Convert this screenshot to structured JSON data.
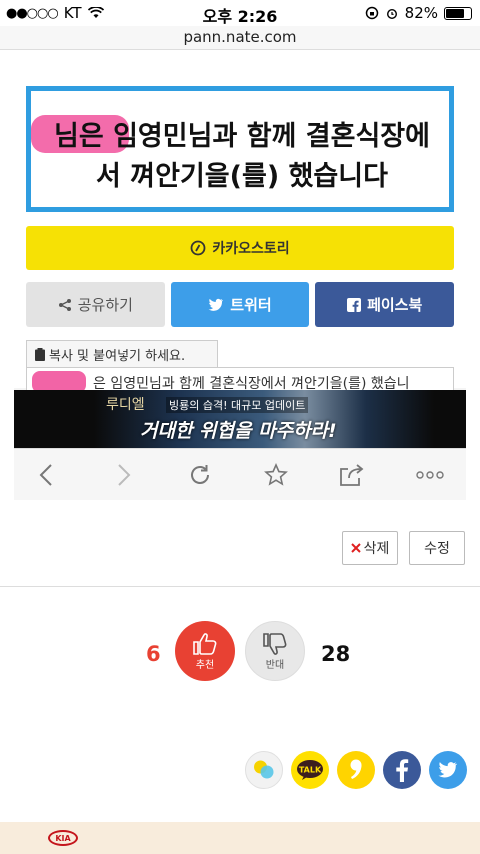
{
  "status_bar": {
    "signal_dots": "●●○○○",
    "carrier": "KT",
    "time": "오후 2:26",
    "battery": "82%",
    "battery_level": 0.82
  },
  "address_bar": {
    "url": "pann.nate.com"
  },
  "screenshot": {
    "headline": "님은 임영민님과 함께 결혼식장에서 껴안기을(를) 했습니다",
    "kakao_story_label": "카카오스토리",
    "share_label": "공유하기",
    "twitter_label": "트위터",
    "facebook_label": "페이스북",
    "copy_hint": "복사 및 붙여넣기 하세요.",
    "copy_text": "은 임영민님과 함께 결혼식장에서 껴안기을(를) 했습니",
    "ad": {
      "logo": "루디엘",
      "sub": "빙룡의 습격! 대규모 업데이트",
      "main": "거대한 위협을 마주하라!"
    },
    "toolbar": {
      "back_icon": "chevron-left-icon",
      "forward_icon": "chevron-right-icon",
      "reload_icon": "reload-icon",
      "bookmark_icon": "star-icon",
      "share_icon": "share-icon",
      "more_icon": "more-dots-icon"
    }
  },
  "actions": {
    "delete_label": "삭제",
    "edit_label": "수정"
  },
  "votes": {
    "up_count": "6",
    "up_label": "추천",
    "down_count": "28",
    "down_label": "반대"
  },
  "sns": [
    "kakaostory-icon",
    "kakaotalk-icon",
    "kakao-quote-icon",
    "facebook-icon",
    "twitter-icon"
  ],
  "sns_talk_label": "TALK",
  "footer": {
    "logo": "KIA"
  },
  "colors": {
    "accent_blue": "#2f9de0",
    "kakao_yellow": "#f6e105",
    "twitter_blue": "#3d9ee9",
    "facebook_blue": "#3b5999",
    "vote_red": "#e84133"
  }
}
